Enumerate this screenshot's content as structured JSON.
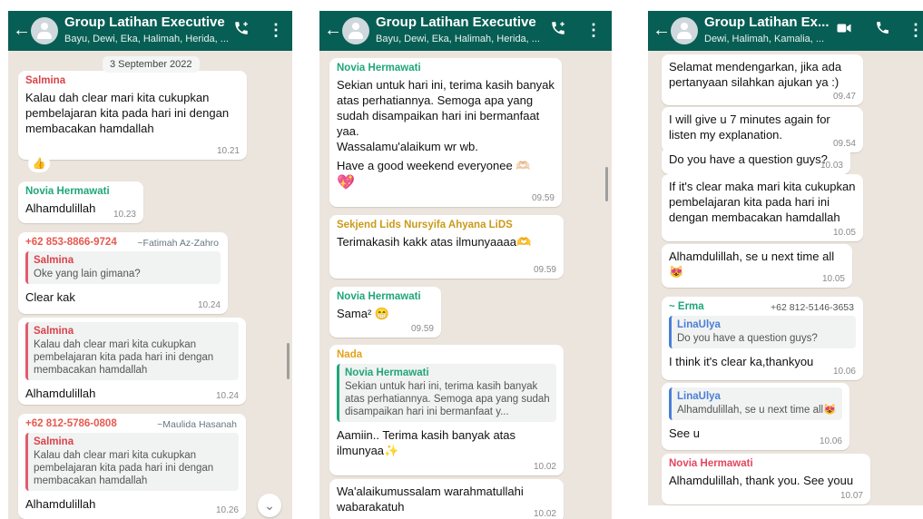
{
  "panels": [
    {
      "header": {
        "back": "←",
        "title": "Group Latihan Executive",
        "subtitle": "Bayu, Dewi, Eka, Halimah, Herida, ...",
        "call_icon": "add-call-icon",
        "menu": "⋮"
      },
      "date_chip": "3 September 2022",
      "messages": [
        {
          "sender": "Salmina",
          "text": "Kalau dah clear mari kita cukupkan pembelajaran kita pada hari ini dengan membacakan hamdallah",
          "time": "10.21"
        },
        {
          "reaction": "👍"
        },
        {
          "sender": "Novia Hermawati",
          "text": "Alhamdulillah",
          "time": "10.23"
        },
        {
          "phone": "+62 853-8866-9724",
          "profile_name": "~Fatimah Az-Zahro",
          "quote_sender": "Salmina",
          "quote_text": "Oke yang lain gimana?",
          "text": "Clear kak",
          "time": "10.24"
        },
        {
          "quote_sender": "Salmina",
          "quote_text": "Kalau dah clear mari kita cukupkan pembelajaran kita pada hari ini dengan membacakan hamdallah",
          "text": "Alhamdulillah",
          "time": "10.24"
        },
        {
          "phone": "+62 812-5786-0808",
          "profile_name": "~Maulida Hasanah",
          "quote_sender": "Salmina",
          "quote_text": "Kalau dah clear mari kita cukupkan pembelajaran kita pada hari ini dengan membacakan hamdallah",
          "text": "Alhamdulillah",
          "time": "10.26"
        }
      ]
    },
    {
      "header": {
        "back": "←",
        "title": "Group Latihan Executive",
        "subtitle": "Bayu, Dewi, Eka, Halimah, Herida, ...",
        "call_icon": "add-call-icon",
        "menu": "⋮"
      },
      "messages": [
        {
          "sender": "Novia Hermawati",
          "text": "Sekian untuk hari ini, terima kasih banyak atas perhatiannya. Semoga apa yang sudah disampaikan hari ini bermanfaat yaa.",
          "text2": "Wassalamu'alaikum wr wb.",
          "text3": "Have a good weekend everyonee 🫶🏻",
          "text4": "💖",
          "time": "09.59"
        },
        {
          "sender": "Sekjend Lids Nursyifa Ahyana LiDS",
          "text": "Terimakasih kakk atas ilmunyaaaa🫶",
          "time": "09.59"
        },
        {
          "sender": "Novia Hermawati",
          "text": "Sama² 😁",
          "time": "09.59"
        },
        {
          "sender": "Nada",
          "quote_sender": "Novia Hermawati",
          "quote_text": "Sekian untuk hari ini, terima kasih banyak atas perhatiannya. Semoga apa yang sudah disampaikan hari ini bermanfaat y...",
          "text": "Aamiin.. Terima kasih banyak atas ilmunyaa✨",
          "time": "10.02"
        },
        {
          "text": "Wa'alaikumussalam warahmatullahi wabarakatuh",
          "time": "10.02"
        }
      ]
    },
    {
      "header": {
        "back": "←",
        "title": "Group Latihan Ex...",
        "subtitle": "Dewi, Halimah, Kamalia, ...",
        "video_icon": "video-call-icon",
        "call_icon": "phone-icon",
        "menu": "⋮"
      },
      "messages": [
        {
          "text": "Selamat mendengarkan, jika ada pertanyaan silahkan ajukan ya :)",
          "time": "09.47"
        },
        {
          "text": "I will give u 7 minutes again for listen my explanation.",
          "time": "09.54"
        },
        {
          "text": "Do you have a question guys?",
          "time": "10.03"
        },
        {
          "text": "If it's clear maka mari kita cukupkan pembelajaran kita pada hari ini dengan membacakan hamdallah",
          "time": "10.05"
        },
        {
          "text": "Alhamdulillah, se u next time all😻",
          "time": "10.05"
        },
        {
          "sender": "~ Erma",
          "phone": "+62 812-5146-3653",
          "quote_sender": "LinaUlya",
          "quote_text": "Do you have a question guys?",
          "text": "I think it's clear ka,thankyou",
          "time": "10.06"
        },
        {
          "quote_sender": "LinaUlya",
          "quote_text": "Alhamdulillah, se u next time all😻",
          "text": "See u",
          "time": "10.06"
        },
        {
          "sender": "Novia Hermawati",
          "text": "Alhamdulillah, thank you. See youu",
          "time": "10.07"
        }
      ]
    }
  ],
  "colors": {
    "header": "#075e54",
    "chat_bg": "#ece5dd",
    "salmina": "#d9434a",
    "novia": "#1fa67a",
    "sekjend": "#c99a1a",
    "nada": "#e3a21a",
    "erma": "#1fa67a",
    "linaulya": "#4a7fd6",
    "novia_p3": "#e2475f"
  }
}
